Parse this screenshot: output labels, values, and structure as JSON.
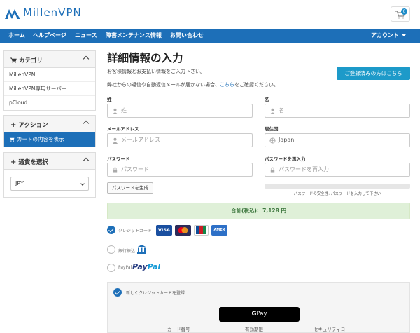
{
  "header": {
    "brand": "MillenVPN",
    "cart_count": "0"
  },
  "nav": {
    "items": [
      "ホーム",
      "ヘルプページ",
      "ニュース",
      "障害メンテナンス情報",
      "お問い合わせ"
    ],
    "account": "アカウント"
  },
  "sidebar": {
    "category": {
      "title": "カテゴリ",
      "items": [
        "MillenVPN",
        "MillenVPN専用サーバー",
        "pCloud"
      ]
    },
    "actions": {
      "title": "アクション",
      "items": [
        "カートの内容を表示"
      ]
    },
    "currency": {
      "title": "通貨を選択",
      "selected": "JPY"
    }
  },
  "main": {
    "title": "詳細情報の入力",
    "subtitle": "お客様情報とお支払い情報をご入力下さい。",
    "notice_pre": "弊社からの返信や自動返信メールが届かない場合、",
    "notice_link": "こちら",
    "notice_post": "をご確認ください。",
    "login_button": "ご登録済みの方はこちら",
    "fields": {
      "lastname_label": "姓",
      "lastname_placeholder": "姓",
      "firstname_label": "名",
      "firstname_placeholder": "名",
      "email_label": "メールアドレス",
      "email_placeholder": "メールアドレス",
      "country_label": "居住国",
      "country_value": "Japan",
      "password_label": "パスワード",
      "password_placeholder": "パスワード",
      "password2_label": "パスワードを再入力",
      "password2_placeholder": "パスワードを再入力"
    },
    "generate_password": "パスワードを生成",
    "strength_text": "パスワードの安全性: パスワードを入力して下さい",
    "total_label": "合計(税込):",
    "total_value": "7,128 円",
    "payment": {
      "credit_label": "クレジットカード",
      "bank_label": "銀行振込",
      "paypal_small": "PayPal",
      "paypal_logo_a": "Pay",
      "paypal_logo_b": "Pal",
      "cards": [
        "VISA",
        "",
        "JCB",
        "AMEX"
      ]
    },
    "new_card": {
      "label": "新しくクレジットカードを登録",
      "gpay_g": "G",
      "gpay_text": "Pay",
      "card_number": "カード番号",
      "expiry": "有効期限",
      "security": "セキュリティコ"
    }
  },
  "colors": {
    "primary": "#1d6fb8",
    "accent": "#1d9ac9",
    "success_bg": "#dff0d8"
  }
}
